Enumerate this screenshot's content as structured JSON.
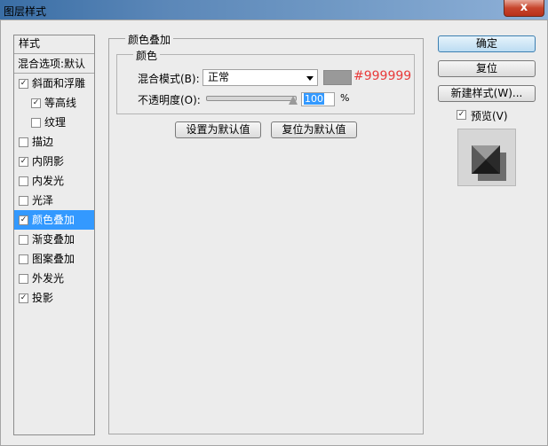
{
  "window": {
    "title": "图层样式",
    "close_label": "x"
  },
  "sidebar": {
    "header": "样式",
    "blend_options": "混合选项:默认",
    "items": [
      {
        "label": "斜面和浮雕",
        "checked": true
      },
      {
        "label": "等高线",
        "checked": true
      },
      {
        "label": "纹理",
        "checked": false
      },
      {
        "label": "描边",
        "checked": false
      },
      {
        "label": "内阴影",
        "checked": true
      },
      {
        "label": "内发光",
        "checked": false
      },
      {
        "label": "光泽",
        "checked": false
      },
      {
        "label": "颜色叠加",
        "checked": true,
        "selected": true
      },
      {
        "label": "渐变叠加",
        "checked": false
      },
      {
        "label": "图案叠加",
        "checked": false
      },
      {
        "label": "外发光",
        "checked": false
      },
      {
        "label": "投影",
        "checked": true
      }
    ]
  },
  "panel": {
    "title": "颜色叠加",
    "group_title": "颜色",
    "blend_mode_label": "混合模式(B):",
    "blend_mode_value": "正常",
    "color_hex": "#999999",
    "opacity_label": "不透明度(O):",
    "opacity_value": "100",
    "opacity_unit": "%",
    "set_default": "设置为默认值",
    "reset_default": "复位为默认值"
  },
  "actions": {
    "ok": "确定",
    "reset": "复位",
    "new_style": "新建样式(W)...",
    "preview_label": "预览(V)",
    "preview_checked": true
  },
  "colors": {
    "overlay": "#999999",
    "selection": "#3399ff",
    "hex_text": "#e83b3b"
  }
}
